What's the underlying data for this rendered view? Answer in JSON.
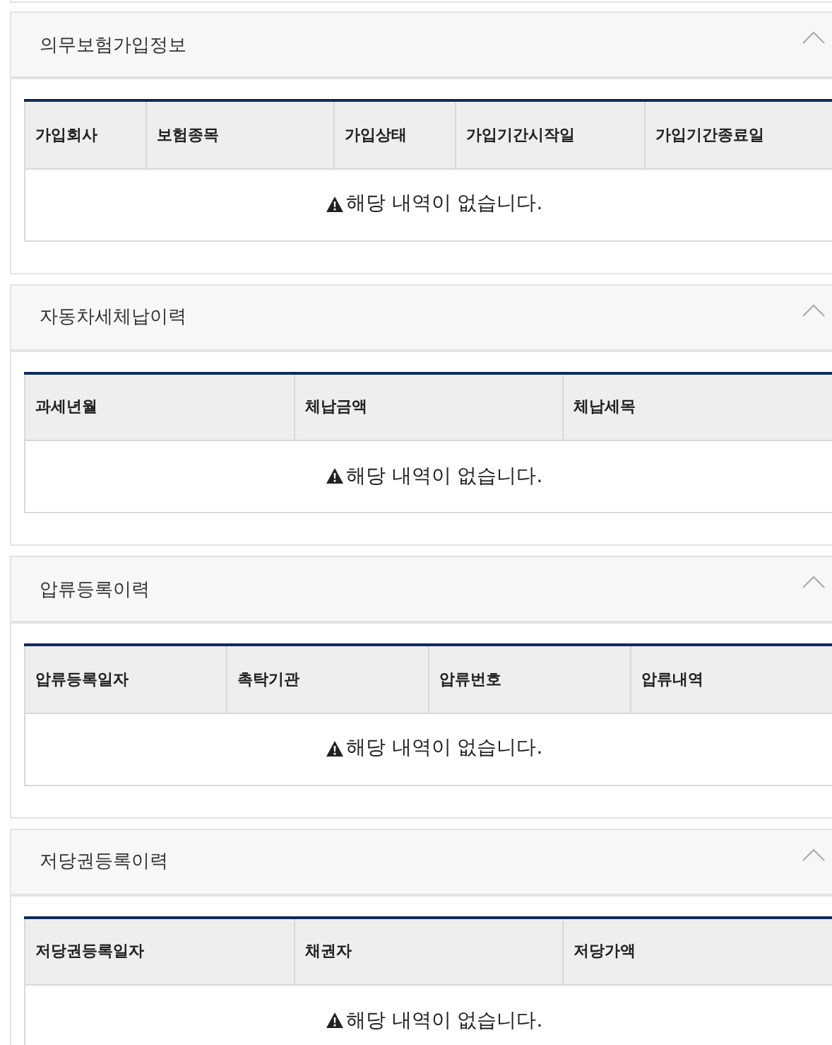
{
  "sections": [
    {
      "title": "의무보험가입정보",
      "expanded": true,
      "columns": [
        "가입회사",
        "보험종목",
        "가입상태",
        "가입기간시작일",
        "가입기간종료일"
      ],
      "empty_message": "해당 내역이 없습니다."
    },
    {
      "title": "자동차세체납이력",
      "expanded": true,
      "columns": [
        "과세년월",
        "체납금액",
        "체납세목"
      ],
      "empty_message": "해당 내역이 없습니다."
    },
    {
      "title": "압류등록이력",
      "expanded": true,
      "columns": [
        "압류등록일자",
        "촉탁기관",
        "압류번호",
        "압류내역"
      ],
      "empty_message": "해당 내역이 없습니다."
    },
    {
      "title": "저당권등록이력",
      "expanded": true,
      "columns": [
        "저당권등록일자",
        "채권자",
        "저당가액"
      ],
      "empty_message": "해당 내역이 없습니다."
    }
  ]
}
